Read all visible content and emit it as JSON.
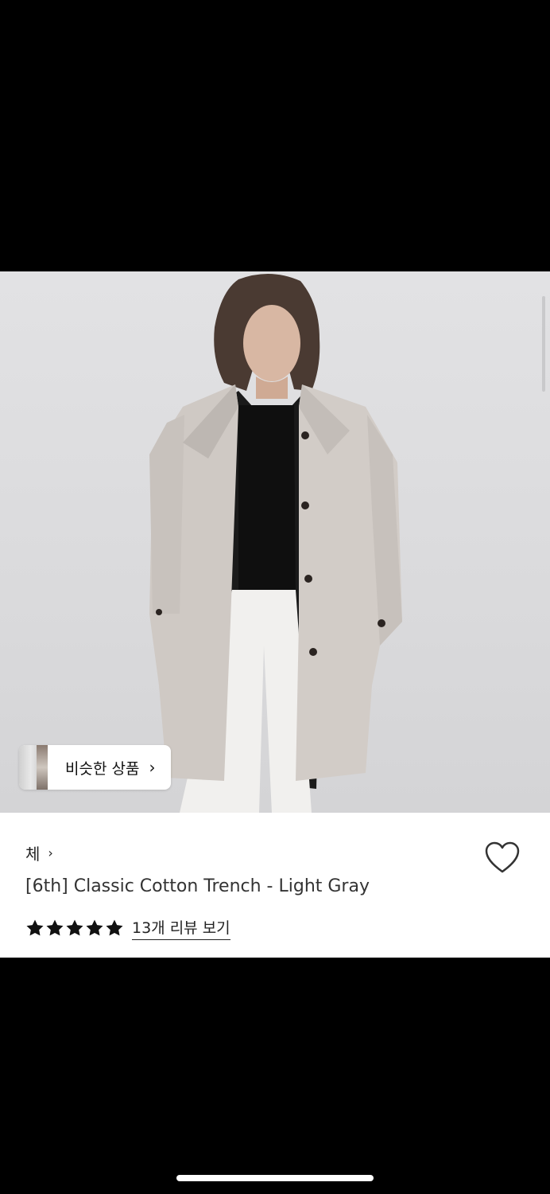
{
  "similar_products": {
    "label": "비슷한 상품",
    "chevron": "›"
  },
  "product": {
    "brand": "체",
    "brand_chevron": "›",
    "title": "[6th] Classic Cotton Trench - Light Gray",
    "rating": 5,
    "reviews_link": "13개 리뷰 보기"
  },
  "colors": {
    "background": "#000000",
    "panel": "#ffffff",
    "text": "#222222"
  },
  "icons": {
    "heart": "heart-outline-icon",
    "star": "star-filled-icon"
  }
}
